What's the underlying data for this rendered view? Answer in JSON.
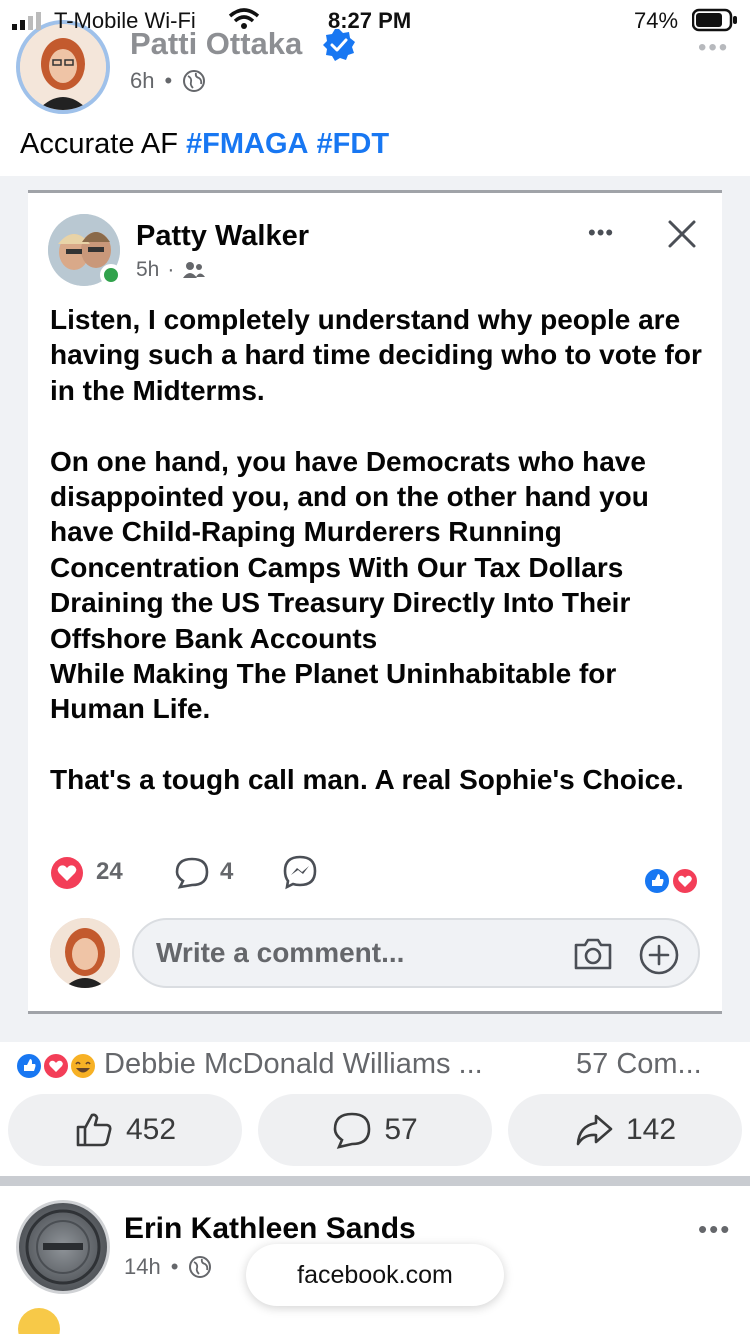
{
  "status_bar": {
    "carrier": "T-Mobile Wi-Fi",
    "time": "8:27 PM",
    "battery": "74%"
  },
  "post": {
    "author": "Patti Ottaka",
    "time": "6h",
    "caption_text": "Accurate AF ",
    "hashtags": [
      "#FMAGA",
      "#FDT"
    ]
  },
  "embedded": {
    "author": "Patty Walker",
    "time": "5h",
    "body": "Listen, I completely understand why people are having such a hard time deciding who to vote for in the Midterms.\n\nOn one hand, you have Democrats who have disappointed you, and on the other hand you have Child-Raping Murderers Running Concentration Camps With Our Tax Dollars Draining the US Treasury Directly Into Their Offshore Bank Accounts\nWhile Making The Planet Uninhabitable for Human Life.\n\nThat's a tough call man. A real Sophie's Choice.",
    "reaction_count": "24",
    "comment_count": "4",
    "comment_placeholder": "Write a comment..."
  },
  "summary": {
    "reactors": "Debbie McDonald Williams ...",
    "comments": "57 Com..."
  },
  "actions": {
    "like": "452",
    "comment": "57",
    "share": "142"
  },
  "next_post": {
    "author": "Erin Kathleen Sands",
    "time": "14h"
  },
  "browser": {
    "url": "facebook.com"
  },
  "colors": {
    "accent": "#1877f2",
    "love": "#f33e58",
    "online": "#31a24c"
  }
}
